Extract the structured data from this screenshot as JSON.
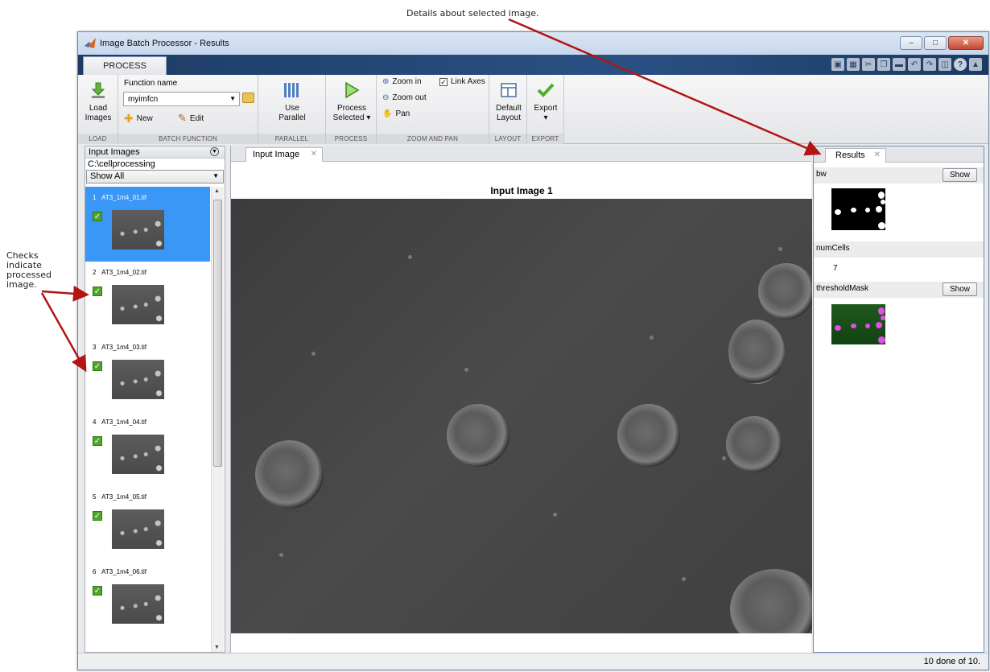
{
  "annotations": {
    "top": "Details about selected image.",
    "left_lines": [
      "Checks",
      "indicate",
      "processed",
      "image."
    ]
  },
  "window": {
    "title": "Image Batch Processor - Results"
  },
  "ribbon": {
    "tab": "PROCESS",
    "load": {
      "line1": "Load",
      "line2": "Images",
      "group": "LOAD"
    },
    "batch_function": {
      "label": "Function name",
      "value": "myimfcn",
      "new_label": "New",
      "edit_label": "Edit",
      "group": "BATCH FUNCTION"
    },
    "parallel": {
      "line1": "Use",
      "line2": "Parallel",
      "group": "PARALLEL"
    },
    "process": {
      "line1": "Process",
      "line2": "Selected",
      "group": "PROCESS"
    },
    "zoom": {
      "zoom_in": "Zoom in",
      "zoom_out": "Zoom out",
      "pan": "Pan",
      "link_axes": "Link Axes",
      "group": "ZOOM AND PAN"
    },
    "layout": {
      "line1": "Default",
      "line2": "Layout",
      "group": "LAYOUT"
    },
    "export": {
      "line1": "Export",
      "group": "EXPORT"
    }
  },
  "input_images": {
    "header": "Input Images",
    "path": "C:\\cellprocessing",
    "filter": "Show All",
    "items": [
      {
        "index": "1",
        "name": "AT3_1m4_01.tif",
        "checked": true,
        "selected": true
      },
      {
        "index": "2",
        "name": "AT3_1m4_02.tif",
        "checked": true,
        "selected": false
      },
      {
        "index": "3",
        "name": "AT3_1m4_03.tif",
        "checked": true,
        "selected": false
      },
      {
        "index": "4",
        "name": "AT3_1m4_04.tif",
        "checked": true,
        "selected": false
      },
      {
        "index": "5",
        "name": "AT3_1m4_05.tif",
        "checked": true,
        "selected": false
      },
      {
        "index": "6",
        "name": "AT3_1m4_06.tif",
        "checked": true,
        "selected": false
      }
    ]
  },
  "center": {
    "tab": "Input Image",
    "image_title": "Input Image 1"
  },
  "results": {
    "tab": "Results",
    "bw_label": "bw",
    "show_label": "Show",
    "numcells_label": "numCells",
    "numcells_value": "7",
    "threshold_label": "thresholdMask"
  },
  "status": {
    "text": "10 done of 10."
  },
  "colors": {
    "selection": "#3b97f5",
    "ribbon_band": "#2a5084",
    "check": "#4ea52a",
    "arrow": "#b31515",
    "mask_magenta": "#e34de6",
    "mask_green": "#1f5a1c"
  }
}
